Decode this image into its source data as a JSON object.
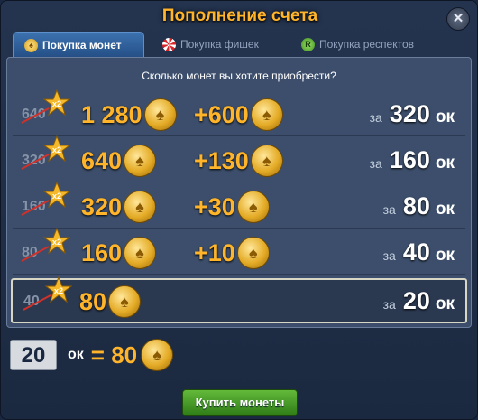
{
  "window": {
    "title": "Пополнение счета",
    "close_glyph": "✕",
    "accent_color": "#ffb42a",
    "button_color": "#3d9a22"
  },
  "tabs": [
    {
      "label": "Покупка монет",
      "icon": "coin-icon",
      "icon_glyph": "♠",
      "active": true
    },
    {
      "label": "Покупка фишек",
      "icon": "chip-icon",
      "icon_glyph": "",
      "active": false
    },
    {
      "label": "Покупка респектов",
      "icon": "respect-icon",
      "icon_glyph": "R",
      "active": false
    }
  ],
  "question": "Сколько монет вы хотите приобрести?",
  "currency_label": "ок",
  "price_prefix": "за",
  "multiplier": "x2",
  "coin_glyph": "♠",
  "options": [
    {
      "old": "640",
      "coins": "1 280",
      "bonus": "+600",
      "price": "320",
      "selected": false
    },
    {
      "old": "320",
      "coins": "640",
      "bonus": "+130",
      "price": "160",
      "selected": false
    },
    {
      "old": "160",
      "coins": "320",
      "bonus": "+30",
      "price": "80",
      "selected": false
    },
    {
      "old": "80",
      "coins": "160",
      "bonus": "+10",
      "price": "40",
      "selected": false
    },
    {
      "old": "40",
      "coins": "80",
      "bonus": "",
      "price": "20",
      "selected": true
    }
  ],
  "summary": {
    "amount": "20",
    "currency": "ок",
    "equals": "= 80"
  },
  "buy_button": "Купить монеты"
}
